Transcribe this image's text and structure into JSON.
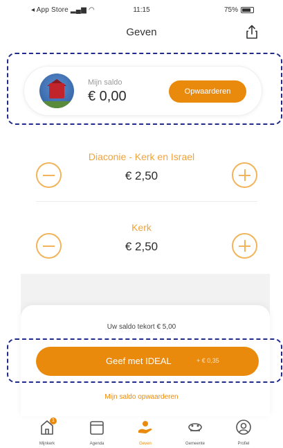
{
  "status_bar": {
    "carrier": "App Store",
    "time": "11:15",
    "battery": "75%"
  },
  "header": {
    "title": "Geven"
  },
  "wallet": {
    "label": "Mijn saldo",
    "amount": "€ 0,00",
    "topup_label": "Opwaarderen"
  },
  "goals": [
    {
      "name": "Diaconie - Kerk en Israel",
      "amount": "€ 2,50"
    },
    {
      "name": "Kerk",
      "amount": "€ 2,50"
    }
  ],
  "payment": {
    "balance_note": "Uw saldo tekort € 5,00",
    "ideal_label": "Geef met IDEAL",
    "ideal_fee": "+ € 0,35",
    "topup_link": "Mijn saldo opwaarderen"
  },
  "tabbar": {
    "items": [
      {
        "label": "Mijnkerk",
        "icon": "church-home-icon",
        "badge": "1"
      },
      {
        "label": "Agenda",
        "icon": "calendar-icon"
      },
      {
        "label": "Geven",
        "icon": "give-hand-icon",
        "active": true
      },
      {
        "label": "Gemeente",
        "icon": "community-icon"
      },
      {
        "label": "Profiel",
        "icon": "profile-icon"
      }
    ]
  },
  "colors": {
    "accent": "#ea8a0c",
    "accent_light": "#f2b45a",
    "annotation": "#1f2a8a"
  }
}
